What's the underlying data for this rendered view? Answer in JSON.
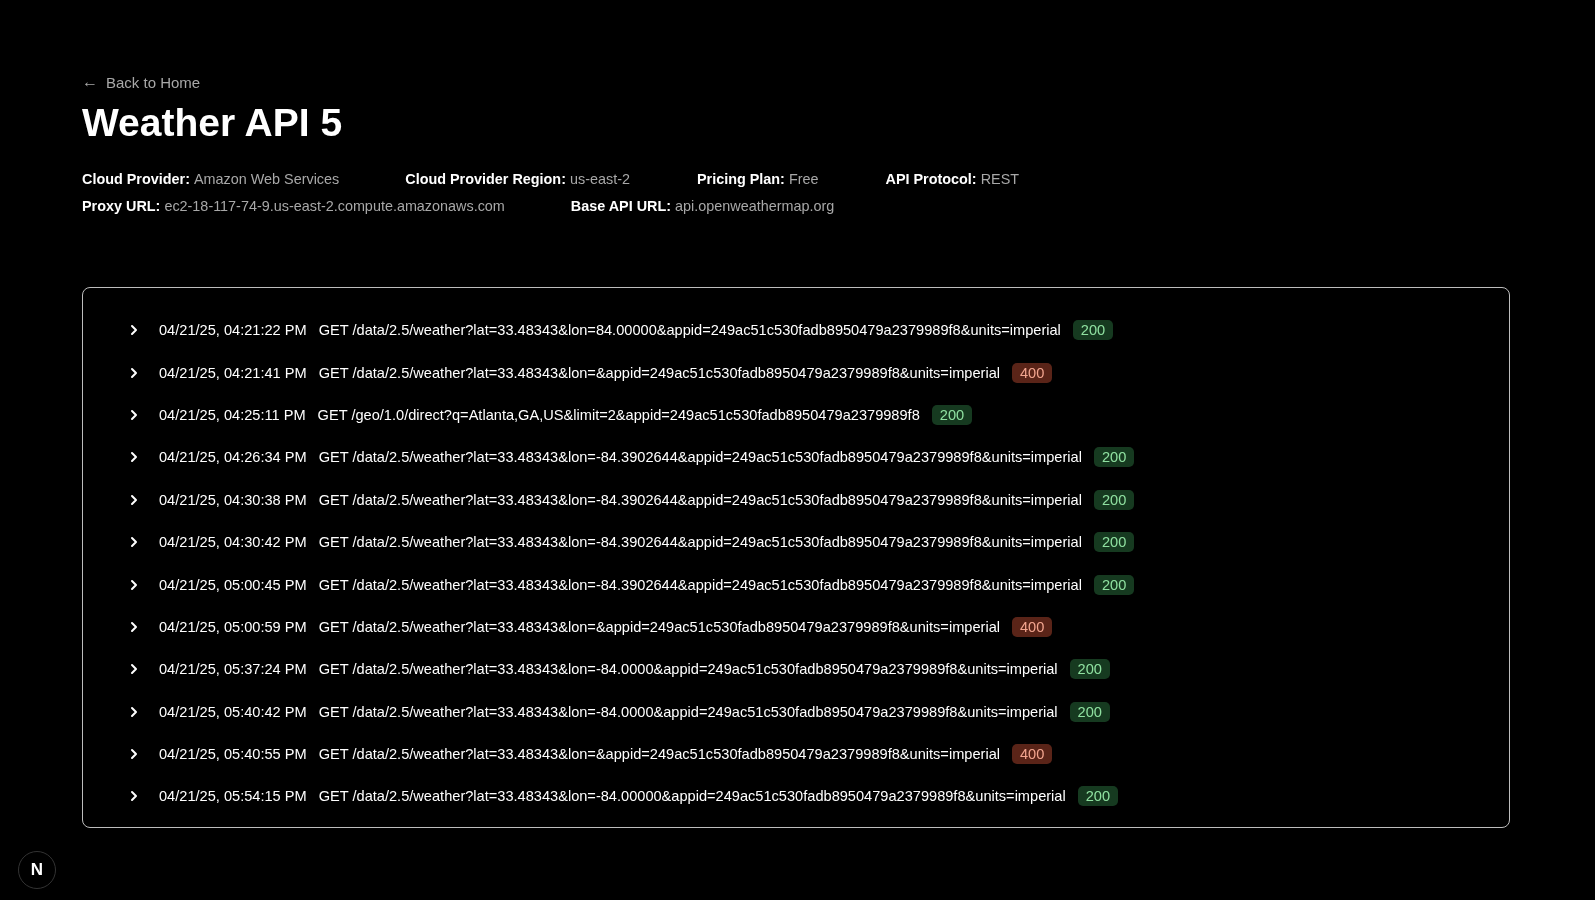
{
  "back_link": {
    "arrow": "←",
    "label": "Back to Home"
  },
  "title": "Weather API 5",
  "meta": [
    [
      {
        "label": "Cloud Provider:",
        "value": "Amazon Web Services"
      },
      {
        "label": "Cloud Provider Region:",
        "value": "us-east-2"
      },
      {
        "label": "Pricing Plan:",
        "value": "Free"
      },
      {
        "label": "API Protocol:",
        "value": "REST"
      }
    ],
    [
      {
        "label": "Proxy URL:",
        "value": "ec2-18-117-74-9.us-east-2.compute.amazonaws.com"
      },
      {
        "label": "Base API URL:",
        "value": "api.openweathermap.org"
      }
    ]
  ],
  "requests": [
    {
      "expanded": false,
      "time": "04/21/25, 04:21:22 PM",
      "request": "GET /data/2.5/weather?lat=33.48343&lon=84.00000&appid=249ac51c530fadb8950479a2379989f8&units=imperial",
      "status": "200",
      "kind": "success"
    },
    {
      "expanded": false,
      "time": "04/21/25, 04:21:41 PM",
      "request": "GET /data/2.5/weather?lat=33.48343&lon=&appid=249ac51c530fadb8950479a2379989f8&units=imperial",
      "status": "400",
      "kind": "error"
    },
    {
      "expanded": false,
      "time": "04/21/25, 04:25:11 PM",
      "request": "GET /geo/1.0/direct?q=Atlanta,GA,US&limit=2&appid=249ac51c530fadb8950479a2379989f8",
      "status": "200",
      "kind": "success"
    },
    {
      "expanded": false,
      "time": "04/21/25, 04:26:34 PM",
      "request": "GET /data/2.5/weather?lat=33.48343&lon=-84.3902644&appid=249ac51c530fadb8950479a2379989f8&units=imperial",
      "status": "200",
      "kind": "success"
    },
    {
      "expanded": false,
      "time": "04/21/25, 04:30:38 PM",
      "request": "GET /data/2.5/weather?lat=33.48343&lon=-84.3902644&appid=249ac51c530fadb8950479a2379989f8&units=imperial",
      "status": "200",
      "kind": "success"
    },
    {
      "expanded": false,
      "time": "04/21/25, 04:30:42 PM",
      "request": "GET /data/2.5/weather?lat=33.48343&lon=-84.3902644&appid=249ac51c530fadb8950479a2379989f8&units=imperial",
      "status": "200",
      "kind": "success"
    },
    {
      "expanded": false,
      "time": "04/21/25, 05:00:45 PM",
      "request": "GET /data/2.5/weather?lat=33.48343&lon=-84.3902644&appid=249ac51c530fadb8950479a2379989f8&units=imperial",
      "status": "200",
      "kind": "success"
    },
    {
      "expanded": false,
      "time": "04/21/25, 05:00:59 PM",
      "request": "GET /data/2.5/weather?lat=33.48343&lon=&appid=249ac51c530fadb8950479a2379989f8&units=imperial",
      "status": "400",
      "kind": "error"
    },
    {
      "expanded": false,
      "time": "04/21/25, 05:37:24 PM",
      "request": "GET /data/2.5/weather?lat=33.48343&lon=-84.0000&appid=249ac51c530fadb8950479a2379989f8&units=imperial",
      "status": "200",
      "kind": "success"
    },
    {
      "expanded": false,
      "time": "04/21/25, 05:40:42 PM",
      "request": "GET /data/2.5/weather?lat=33.48343&lon=-84.0000&appid=249ac51c530fadb8950479a2379989f8&units=imperial",
      "status": "200",
      "kind": "success"
    },
    {
      "expanded": false,
      "time": "04/21/25, 05:40:55 PM",
      "request": "GET /data/2.5/weather?lat=33.48343&lon=&appid=249ac51c530fadb8950479a2379989f8&units=imperial",
      "status": "400",
      "kind": "error"
    },
    {
      "expanded": false,
      "time": "04/21/25, 05:54:15 PM",
      "request": "GET /data/2.5/weather?lat=33.48343&lon=-84.00000&appid=249ac51c530fadb8950479a2379989f8&units=imperial",
      "status": "200",
      "kind": "success"
    }
  ],
  "dev_badge": "N"
}
